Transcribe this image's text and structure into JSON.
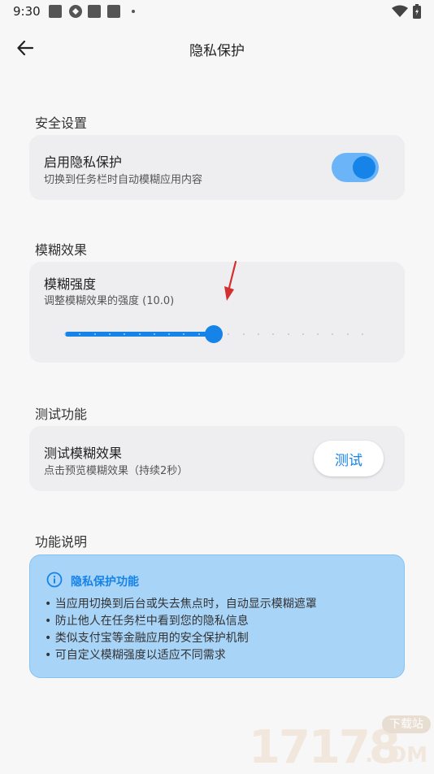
{
  "status_bar": {
    "time": "9:30"
  },
  "appbar": {
    "title": "隐私保护"
  },
  "security": {
    "section_label": "安全设置",
    "title": "启用隐私保护",
    "subtitle": "切换到任务栏时自动模糊应用内容",
    "enabled": true
  },
  "blur": {
    "section_label": "模糊效果",
    "title": "模糊强度",
    "subtitle": "调整模糊效果的强度 (10.0)",
    "slider": {
      "min": 0,
      "max": 20,
      "value": 10,
      "steps": 20
    }
  },
  "test": {
    "section_label": "测试功能",
    "title": "测试模糊效果",
    "subtitle": "点击预览模糊效果（持续2秒）",
    "button_label": "测试"
  },
  "info": {
    "section_label": "功能说明",
    "title": "隐私保护功能",
    "items": [
      "• 当应用切换到后台或失去焦点时，自动显示模糊遮罩",
      "• 防止他人在任务栏中看到您的隐私信息",
      "• 类似支付宝等金融应用的安全保护机制",
      "• 可自定义模糊强度以适应不同需求"
    ]
  },
  "watermark": {
    "number": "17178",
    "badge": "下载站",
    "suffix": ".COM"
  },
  "colors": {
    "accent": "#1583e8",
    "accent_light": "#6ab4f7",
    "info_bg": "#a8d4f8",
    "card_bg": "#eeeef0"
  }
}
